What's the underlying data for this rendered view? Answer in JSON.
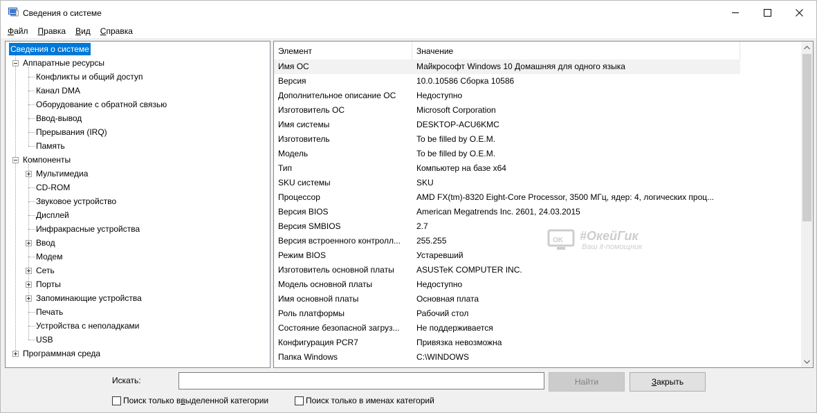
{
  "window": {
    "title": "Сведения о системе",
    "icon": "system-info-icon"
  },
  "menu": [
    {
      "pre": "",
      "key": "Ф",
      "post": "айл"
    },
    {
      "pre": "",
      "key": "П",
      "post": "равка"
    },
    {
      "pre": "",
      "key": "В",
      "post": "ид"
    },
    {
      "pre": "",
      "key": "С",
      "post": "правка"
    }
  ],
  "tree": {
    "root": "Сведения о системе",
    "hardware": "Аппаратные ресурсы",
    "hardware_children": [
      "Конфликты и общий доступ",
      "Канал DMA",
      "Оборудование с обратной связью",
      "Ввод-вывод",
      "Прерывания (IRQ)",
      "Память"
    ],
    "components": "Компоненты",
    "components_children": [
      {
        "label": "Мультимедиа",
        "expandable": true
      },
      {
        "label": "CD-ROM",
        "expandable": false
      },
      {
        "label": "Звуковое устройство",
        "expandable": false
      },
      {
        "label": "Дисплей",
        "expandable": false
      },
      {
        "label": "Инфракрасные устройства",
        "expandable": false
      },
      {
        "label": "Ввод",
        "expandable": true
      },
      {
        "label": "Модем",
        "expandable": false
      },
      {
        "label": "Сеть",
        "expandable": true
      },
      {
        "label": "Порты",
        "expandable": true
      },
      {
        "label": "Запоминающие устройства",
        "expandable": true
      },
      {
        "label": "Печать",
        "expandable": false
      },
      {
        "label": "Устройства с неполадками",
        "expandable": false
      },
      {
        "label": "USB",
        "expandable": false
      }
    ],
    "software": "Программная среда"
  },
  "list": {
    "columns": [
      "Элемент",
      "Значение"
    ],
    "rows": [
      [
        "Имя ОС",
        "Майкрософт Windows 10 Домашняя для одного языка"
      ],
      [
        "Версия",
        "10.0.10586 Сборка 10586"
      ],
      [
        "Дополнительное описание ОС",
        "Недоступно"
      ],
      [
        "Изготовитель ОС",
        "Microsoft Corporation"
      ],
      [
        "Имя системы",
        "DESKTOP-ACU6KMC"
      ],
      [
        "Изготовитель",
        "To be filled by O.E.M."
      ],
      [
        "Модель",
        "To be filled by O.E.M."
      ],
      [
        "Тип",
        "Компьютер на базе x64"
      ],
      [
        "SKU системы",
        "SKU"
      ],
      [
        "Процессор",
        "AMD FX(tm)-8320 Eight-Core Processor, 3500 МГц, ядер: 4, логических проц..."
      ],
      [
        "Версия BIOS",
        "American Megatrends Inc. 2601, 24.03.2015"
      ],
      [
        "Версия SMBIOS",
        "2.7"
      ],
      [
        "Версия встроенного контролл...",
        "255.255"
      ],
      [
        "Режим BIOS",
        "Устаревший"
      ],
      [
        "Изготовитель основной платы",
        "ASUSTeK COMPUTER INC."
      ],
      [
        "Модель основной платы",
        "Недоступно"
      ],
      [
        "Имя основной платы",
        "Основная плата"
      ],
      [
        "Роль платформы",
        "Рабочий стол"
      ],
      [
        "Состояние безопасной загруз...",
        "Не поддерживается"
      ],
      [
        "Конфигурация PCR7",
        "Привязка невозможна"
      ],
      [
        "Папка Windows",
        "C:\\WINDOWS"
      ]
    ]
  },
  "watermark": {
    "line1": "#ОкейГик",
    "line2": "Ваш it-помощник"
  },
  "search": {
    "label": "Искать:",
    "value": "",
    "placeholder": ""
  },
  "buttons": {
    "find": "Найти",
    "close_key": "З",
    "close_rest": "акрыть"
  },
  "checks": {
    "selected_pre": "Поиск только в ",
    "selected_key": "в",
    "selected_post": "ыделенной категории",
    "names_pre": "Поиск только в именах категорий"
  }
}
